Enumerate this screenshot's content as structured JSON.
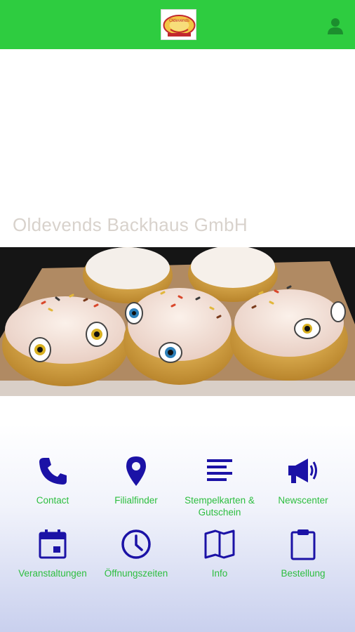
{
  "header": {
    "logo_text": "Oldevends",
    "profile_icon": "user-icon",
    "bar_color": "#2ecc40"
  },
  "main": {
    "company_name": "Oldevends Backhaus GmbH"
  },
  "nav": {
    "icon_color": "#1b12a6",
    "label_color": "#2dbe3f",
    "items": [
      {
        "label": "Contact",
        "icon": "phone-icon"
      },
      {
        "label": "Filialfinder",
        "icon": "location-pin-icon"
      },
      {
        "label": "Stempelkarten & Gutschein",
        "icon": "text-lines-icon"
      },
      {
        "label": "Newscenter",
        "icon": "megaphone-icon"
      },
      {
        "label": "Veranstaltungen",
        "icon": "calendar-icon"
      },
      {
        "label": "Öffnungszeiten",
        "icon": "clock-icon"
      },
      {
        "label": "Info",
        "icon": "book-icon"
      },
      {
        "label": "Bestellung",
        "icon": "clipboard-icon"
      }
    ]
  }
}
